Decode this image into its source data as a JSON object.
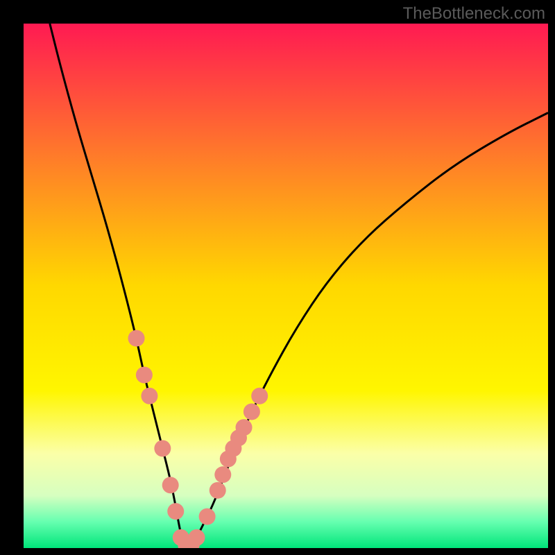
{
  "watermark": "TheBottleneck.com",
  "chart_data": {
    "type": "line",
    "title": "",
    "xlabel": "",
    "ylabel": "",
    "xlim": [
      0,
      100
    ],
    "ylim": [
      0,
      100
    ],
    "background_gradient": [
      {
        "pos": 0.0,
        "color": "#ff1a52"
      },
      {
        "pos": 0.25,
        "color": "#ff7a2a"
      },
      {
        "pos": 0.5,
        "color": "#ffd800"
      },
      {
        "pos": 0.7,
        "color": "#fff600"
      },
      {
        "pos": 0.82,
        "color": "#fbffa8"
      },
      {
        "pos": 0.9,
        "color": "#d6ffc0"
      },
      {
        "pos": 0.95,
        "color": "#66ffb0"
      },
      {
        "pos": 1.0,
        "color": "#00e57a"
      }
    ],
    "series": [
      {
        "name": "bottleneck-curve",
        "x": [
          5,
          7,
          10,
          13,
          16,
          19,
          21.5,
          23,
          25,
          26.5,
          28,
          29,
          29.7,
          30.3,
          31,
          31.5,
          32,
          33,
          34,
          36,
          38,
          40,
          43,
          47,
          52,
          58,
          65,
          73,
          82,
          92,
          100
        ],
        "y": [
          100,
          92,
          81,
          71,
          61,
          50,
          40,
          33,
          25,
          19,
          13,
          8,
          4,
          1.5,
          0.5,
          0.5,
          1,
          2,
          4,
          8,
          13,
          18,
          25,
          33,
          42,
          51,
          59,
          66,
          73,
          79,
          83
        ]
      }
    ],
    "markers": [
      {
        "x": 21.5,
        "y": 40,
        "r": 1.6
      },
      {
        "x": 23.0,
        "y": 33,
        "r": 1.6
      },
      {
        "x": 24.0,
        "y": 29,
        "r": 1.6
      },
      {
        "x": 26.5,
        "y": 19,
        "r": 1.6
      },
      {
        "x": 28.0,
        "y": 12,
        "r": 1.6
      },
      {
        "x": 29.0,
        "y": 7,
        "r": 1.6
      },
      {
        "x": 30.0,
        "y": 2,
        "r": 1.6
      },
      {
        "x": 31.0,
        "y": 0.5,
        "r": 1.6
      },
      {
        "x": 32.0,
        "y": 0.7,
        "r": 1.6
      },
      {
        "x": 33.0,
        "y": 2,
        "r": 1.6
      },
      {
        "x": 35.0,
        "y": 6,
        "r": 1.6
      },
      {
        "x": 37.0,
        "y": 11,
        "r": 1.6
      },
      {
        "x": 38.0,
        "y": 14,
        "r": 1.6
      },
      {
        "x": 39.0,
        "y": 17,
        "r": 1.6
      },
      {
        "x": 40.0,
        "y": 19,
        "r": 1.6
      },
      {
        "x": 41.0,
        "y": 21,
        "r": 1.6
      },
      {
        "x": 42.0,
        "y": 23,
        "r": 1.6
      },
      {
        "x": 43.5,
        "y": 26,
        "r": 1.6
      },
      {
        "x": 45.0,
        "y": 29,
        "r": 1.6
      }
    ],
    "marker_color": "#e98a7f",
    "curve_color": "#000000"
  }
}
